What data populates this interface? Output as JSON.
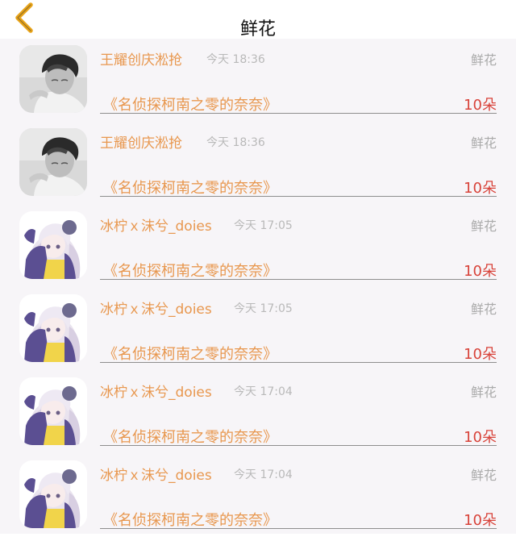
{
  "header": {
    "title": "鲜花",
    "back_icon": "chevron-left-icon"
  },
  "rows": [
    {
      "avatar": "boy-photo",
      "user": "王耀创庆淞抢",
      "time": "今天 18:36",
      "gift_type": "鲜花",
      "gift_name": "《名侦探柯南之零的奈奈》",
      "count": "10朵"
    },
    {
      "avatar": "boy-photo",
      "user": "王耀创庆淞抢",
      "time": "今天 18:36",
      "gift_type": "鲜花",
      "gift_name": "《名侦探柯南之零的奈奈》",
      "count": "10朵"
    },
    {
      "avatar": "anime-girl",
      "user": "冰柠ｘ沫兮_doies",
      "time": "今天 17:05",
      "gift_type": "鲜花",
      "gift_name": "《名侦探柯南之零的奈奈》",
      "count": "10朵"
    },
    {
      "avatar": "anime-girl",
      "user": "冰柠ｘ沫兮_doies",
      "time": "今天 17:05",
      "gift_type": "鲜花",
      "gift_name": "《名侦探柯南之零的奈奈》",
      "count": "10朵"
    },
    {
      "avatar": "anime-girl",
      "user": "冰柠ｘ沫兮_doies",
      "time": "今天 17:04",
      "gift_type": "鲜花",
      "gift_name": "《名侦探柯南之零的奈奈》",
      "count": "10朵"
    },
    {
      "avatar": "anime-girl",
      "user": "冰柠ｘ沫兮_doies",
      "time": "今天 17:04",
      "gift_type": "鲜花",
      "gift_name": "《名侦探柯南之零的奈奈》",
      "count": "10朵"
    }
  ],
  "colors": {
    "accent": "#e8974e",
    "count": "#d8433a",
    "back": "#e8a317"
  }
}
